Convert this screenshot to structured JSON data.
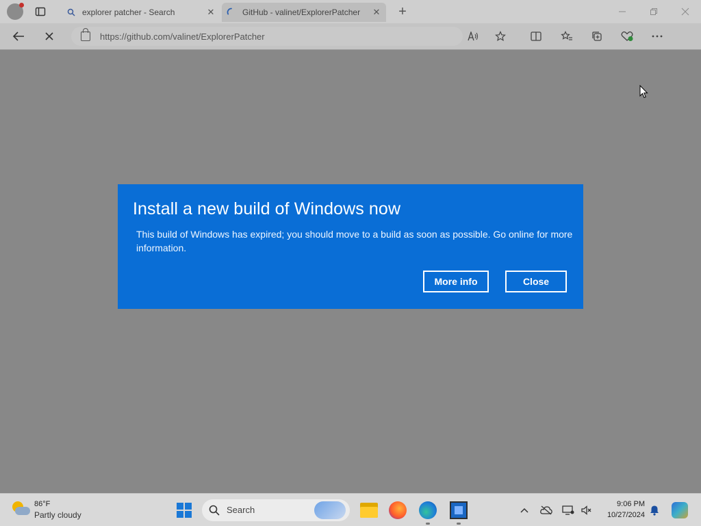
{
  "browser": {
    "tabs": [
      {
        "label": "explorer patcher - Search",
        "icon": "search-icon"
      },
      {
        "label": "GitHub - valinet/ExplorerPatcher",
        "icon": "loading-spinner-icon",
        "active": true
      }
    ],
    "address_url": "https://github.com/valinet/ExplorerPatcher"
  },
  "dialog": {
    "title": "Install a new build of Windows now",
    "message": "This build of Windows has expired; you should move to a build as soon as possible. Go online for more information.",
    "more_info_label": "More info",
    "close_label": "Close",
    "background_color": "#0a6ed6"
  },
  "taskbar": {
    "weather_temp": "86°F",
    "weather_desc": "Partly cloudy",
    "search_label": "Search",
    "time": "9:06 PM",
    "date": "10/27/2024"
  }
}
